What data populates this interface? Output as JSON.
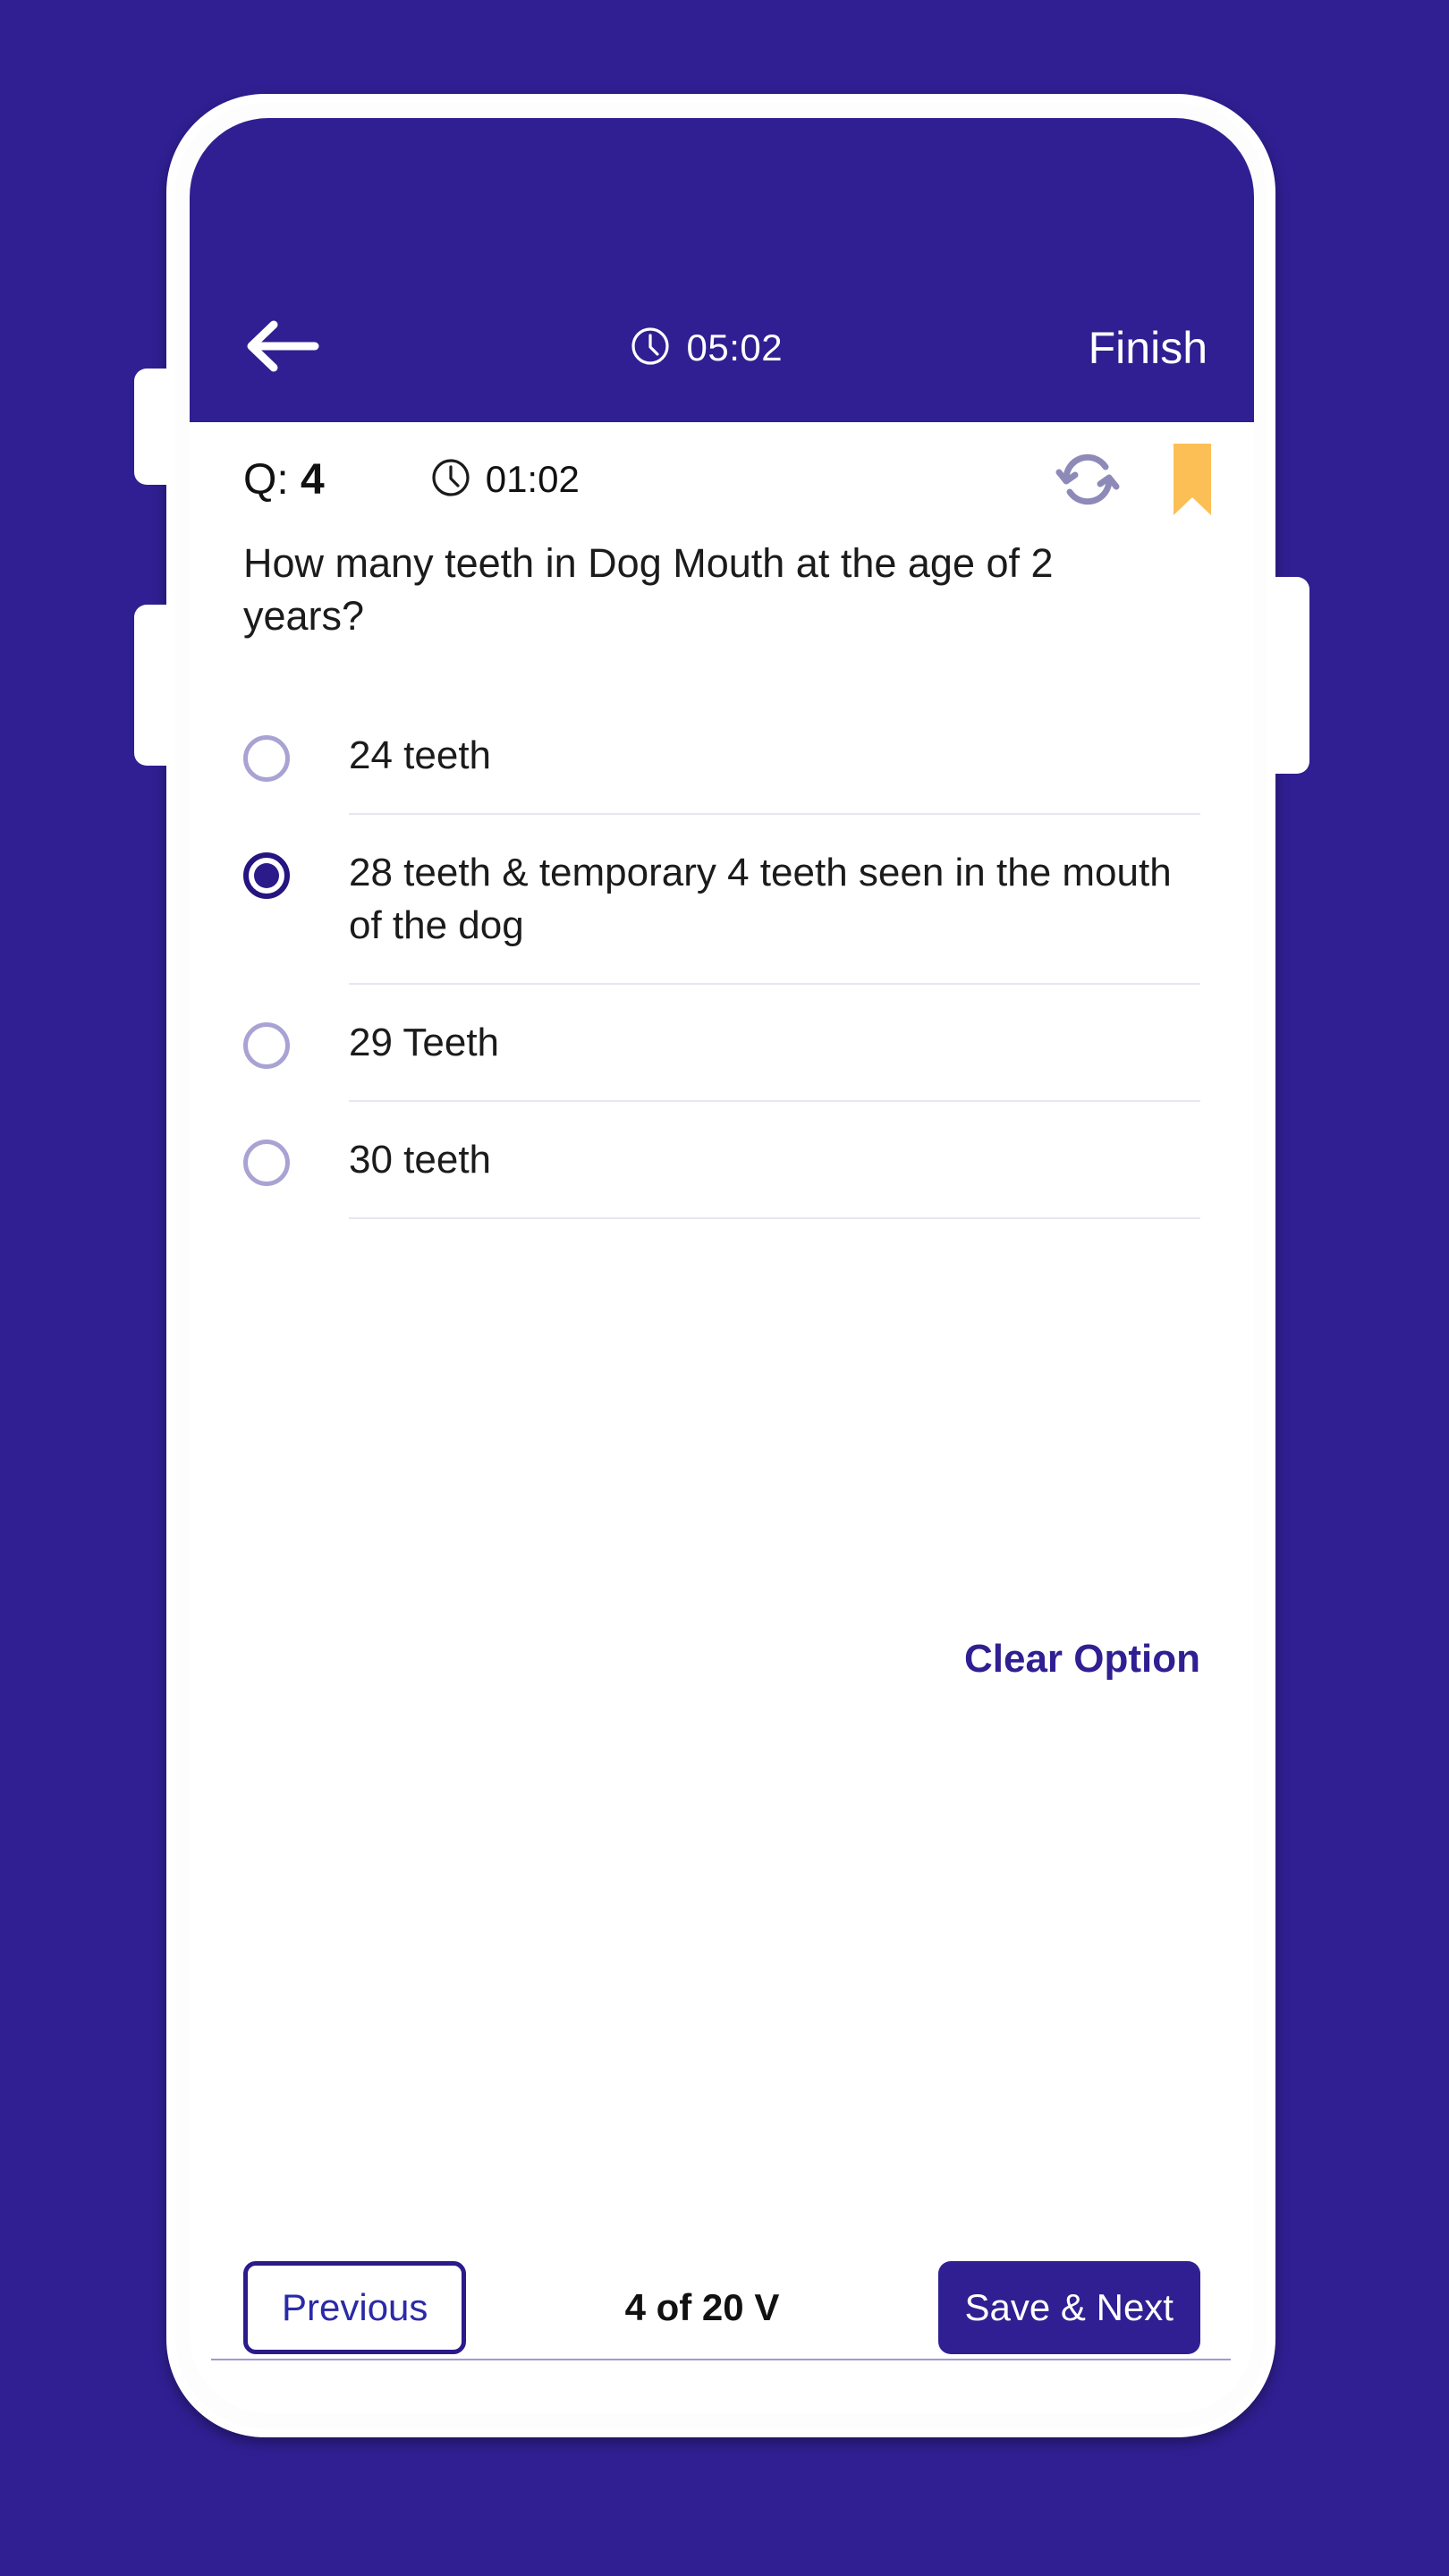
{
  "theme": {
    "background": "#2f1f92",
    "primary": "#2f1f92",
    "accent_bookmark": "#fbbf55",
    "radio_unselected": "#a9a3d4",
    "radio_selected": "#261580",
    "divider": "#e8e6f4"
  },
  "header": {
    "back_icon": "arrow-left-icon",
    "clock_icon": "clock-icon",
    "timer": "05:02",
    "finish_label": "Finish"
  },
  "question_meta": {
    "label": "Q:",
    "number": "4",
    "clock_icon": "clock-icon",
    "timer": "01:02",
    "refresh_icon": "refresh-icon",
    "bookmark_icon": "bookmark-icon"
  },
  "question": {
    "text": "How many teeth in Dog Mouth at the age of 2 years?",
    "options": [
      {
        "label": "24 teeth",
        "selected": false
      },
      {
        "label": "28 teeth & temporary 4 teeth seen in the mouth of the dog",
        "selected": true
      },
      {
        "label": "29 Teeth",
        "selected": false
      },
      {
        "label": "30 teeth",
        "selected": false
      }
    ],
    "clear_option_label": "Clear Option"
  },
  "footer": {
    "previous_label": "Previous",
    "progress": "4 of 20 V",
    "save_next_label": "Save & Next"
  }
}
